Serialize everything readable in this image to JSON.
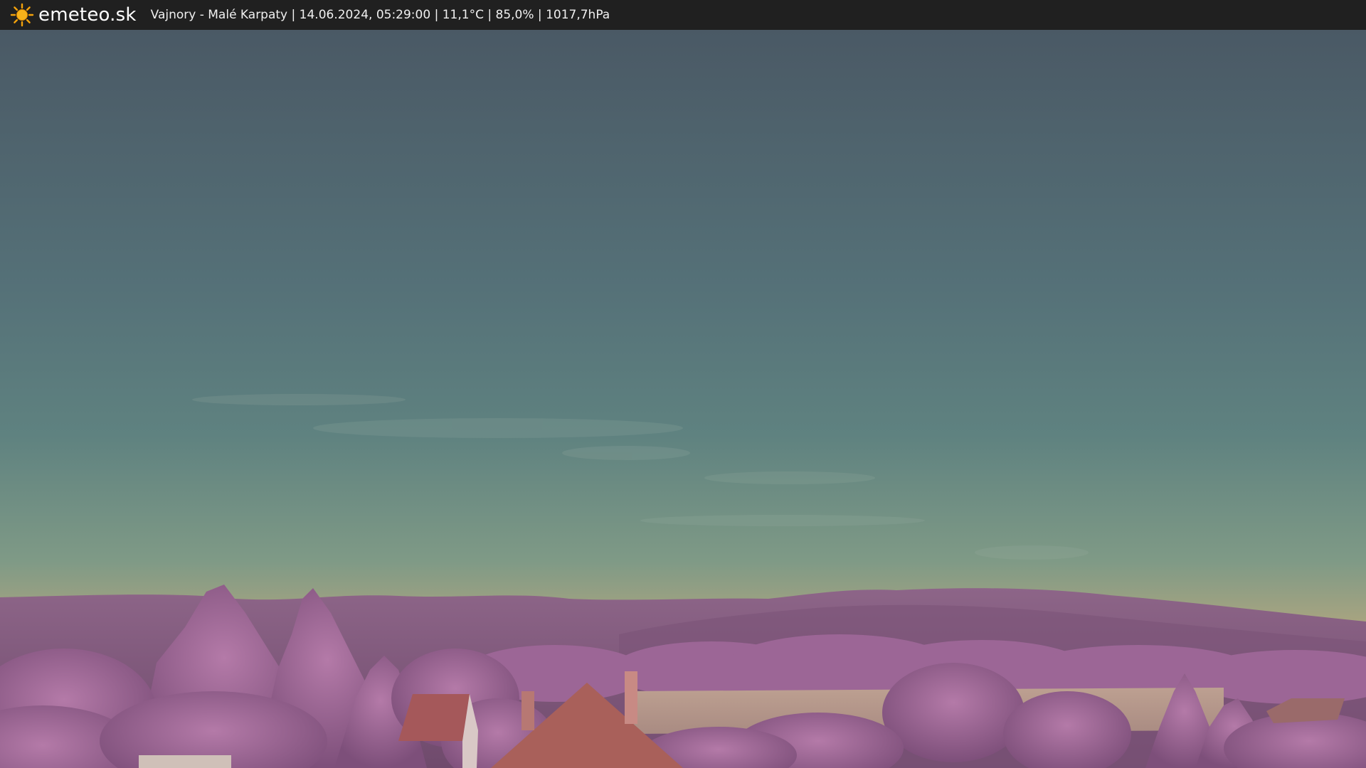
{
  "header": {
    "brand": "emeteo.sk",
    "location": "Vajnory - Malé Karpaty",
    "datetime": "14.06.2024, 05:29:00",
    "temperature": "11,1°C",
    "humidity": "85,0%",
    "pressure": "1017,7hPa",
    "logo_icon": "sun-icon"
  },
  "scene": {
    "description_icon": "webcam-image",
    "colors": {
      "sky_top": "#4b5b66",
      "sky_mid": "#5e7d7e",
      "sky_horizon": "#c9a878",
      "hills": "#8b5f86",
      "trees": "#a06a98",
      "field": "#b99e90",
      "roof": "#a5585a"
    }
  }
}
